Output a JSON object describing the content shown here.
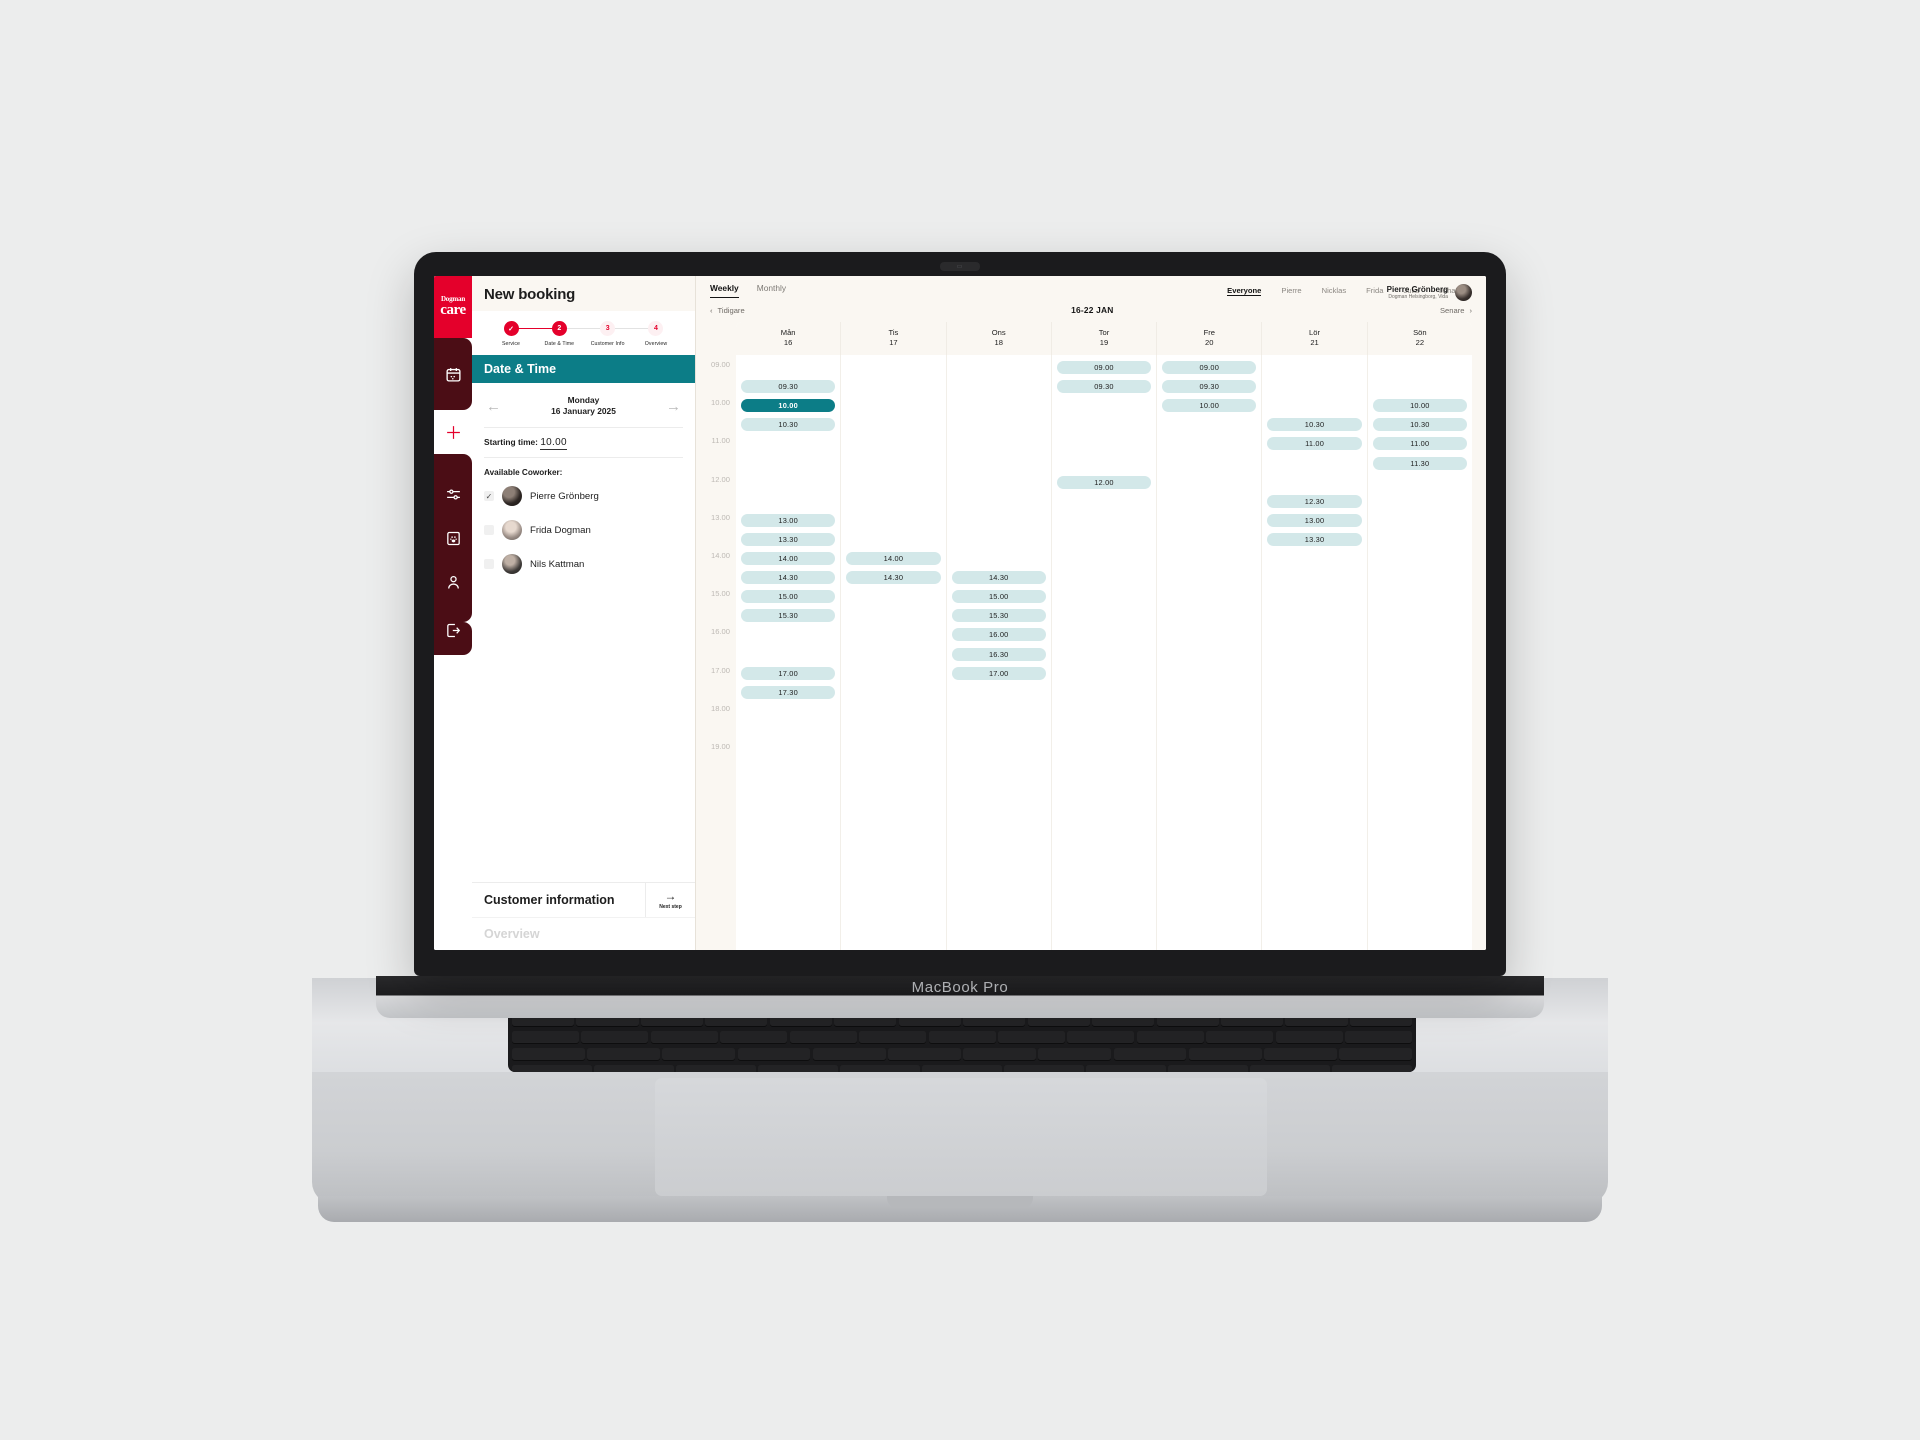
{
  "device": {
    "brand": "MacBook Pro"
  },
  "brand": {
    "logo_top": "Dogman",
    "logo_bottom": "care",
    "red": "#e4002b",
    "teal": "#0c7d87",
    "dark_red": "#4b0d15"
  },
  "header": {
    "title": "New booking"
  },
  "account": {
    "name": "Pierre Grönberg",
    "subtitle": "Dogman Helsingborg, Vida"
  },
  "rail": {
    "items": [
      {
        "icon": "calendar-icon"
      },
      {
        "icon": "plus-icon"
      },
      {
        "icon": "sliders-icon"
      },
      {
        "icon": "paw-book-icon"
      },
      {
        "icon": "person-icon"
      },
      {
        "icon": "logout-icon"
      }
    ]
  },
  "stepper": {
    "steps": [
      {
        "marker": "✓",
        "label": "Service",
        "state": "done"
      },
      {
        "marker": "2",
        "label": "Date & Time",
        "state": "current"
      },
      {
        "marker": "3",
        "label": "Customer Info",
        "state": "todo"
      },
      {
        "marker": "4",
        "label": "Overview",
        "state": "todo"
      }
    ]
  },
  "panel": {
    "section_title": "Date & Time",
    "date_weekday": "Monday",
    "date_full": "16 January 2025",
    "prev_arrow": "←",
    "next_arrow": "→",
    "starting_time_label": "Starting time:",
    "starting_time_value": "10.00",
    "coworker_label": "Available Coworker:",
    "coworkers": [
      {
        "name": "Pierre Grönberg",
        "checked": true
      },
      {
        "name": "Frida Dogman",
        "checked": false
      },
      {
        "name": "Nils Kattman",
        "checked": false
      }
    ],
    "footer_primary": "Customer information",
    "footer_button_arrow": "→",
    "footer_button_label": "Next step",
    "footer_ghost": "Overview"
  },
  "calendar": {
    "view_tabs": [
      {
        "label": "Weekly",
        "active": true
      },
      {
        "label": "Monthly",
        "active": false
      }
    ],
    "people_filters": [
      {
        "label": "Everyone",
        "active": true
      },
      {
        "label": "Pierre",
        "active": false
      },
      {
        "label": "Nicklas",
        "active": false
      },
      {
        "label": "Frida",
        "active": false
      },
      {
        "label": "Julia",
        "active": false
      },
      {
        "label": "Johannes",
        "active": false
      }
    ],
    "prev_label": "Tidigare",
    "range_label": "16-22 JAN",
    "next_label": "Senare",
    "time_labels": [
      "09.00",
      "10.00",
      "11.00",
      "12.00",
      "13.00",
      "14.00",
      "15.00",
      "16.00",
      "17.00",
      "18.00",
      "19.00"
    ],
    "day_columns": [
      {
        "name": "Mån",
        "number": "16",
        "slots": [
          {
            "time": "09.30",
            "selected": false
          },
          {
            "time": "10.00",
            "selected": true
          },
          {
            "time": "10.30",
            "selected": false
          },
          {
            "time": "13.00",
            "selected": false
          },
          {
            "time": "13.30",
            "selected": false
          },
          {
            "time": "14.00",
            "selected": false
          },
          {
            "time": "14.30",
            "selected": false
          },
          {
            "time": "15.00",
            "selected": false
          },
          {
            "time": "15.30",
            "selected": false
          },
          {
            "time": "17.00",
            "selected": false
          },
          {
            "time": "17.30",
            "selected": false
          }
        ]
      },
      {
        "name": "Tis",
        "number": "17",
        "slots": [
          {
            "time": "14.00",
            "selected": false
          },
          {
            "time": "14.30",
            "selected": false
          }
        ]
      },
      {
        "name": "Ons",
        "number": "18",
        "slots": [
          {
            "time": "14.30",
            "selected": false
          },
          {
            "time": "15.00",
            "selected": false
          },
          {
            "time": "15.30",
            "selected": false
          },
          {
            "time": "16.00",
            "selected": false
          },
          {
            "time": "16.30",
            "selected": false
          },
          {
            "time": "17.00",
            "selected": false
          }
        ]
      },
      {
        "name": "Tor",
        "number": "19",
        "slots": [
          {
            "time": "09.00",
            "selected": false
          },
          {
            "time": "09.30",
            "selected": false
          },
          {
            "time": "12.00",
            "selected": false
          }
        ]
      },
      {
        "name": "Fre",
        "number": "20",
        "slots": [
          {
            "time": "09.00",
            "selected": false
          },
          {
            "time": "09.30",
            "selected": false
          },
          {
            "time": "10.00",
            "selected": false
          }
        ]
      },
      {
        "name": "Lör",
        "number": "21",
        "slots": [
          {
            "time": "10.30",
            "selected": false
          },
          {
            "time": "11.00",
            "selected": false
          },
          {
            "time": "12.30",
            "selected": false
          },
          {
            "time": "13.00",
            "selected": false
          },
          {
            "time": "13.30",
            "selected": false
          }
        ]
      },
      {
        "name": "Sön",
        "number": "22",
        "slots": [
          {
            "time": "10.00",
            "selected": false
          },
          {
            "time": "10.30",
            "selected": false
          },
          {
            "time": "11.00",
            "selected": false
          },
          {
            "time": "11.30",
            "selected": false
          }
        ]
      }
    ]
  }
}
